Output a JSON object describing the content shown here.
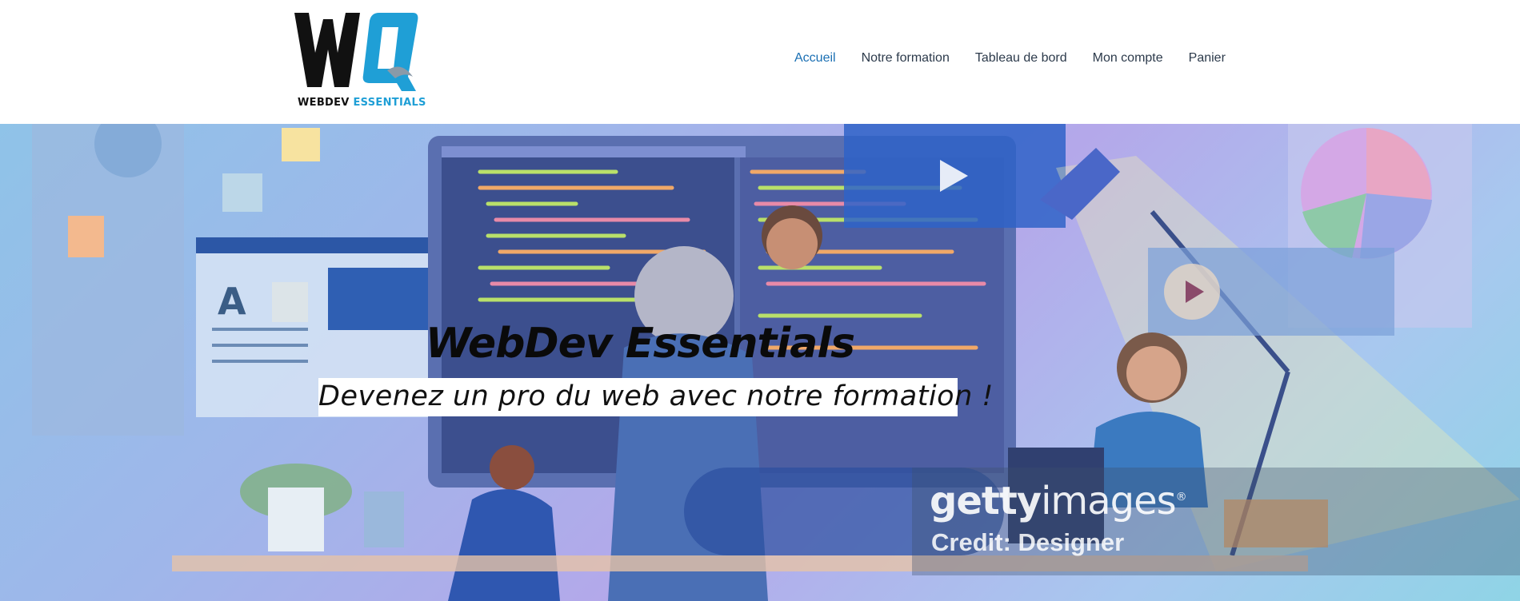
{
  "header": {
    "logo": {
      "monogram": "WQ",
      "word1": "WEBDEV",
      "word2": "ESSENTIALS"
    },
    "nav": [
      {
        "label": "Accueil",
        "active": true
      },
      {
        "label": "Notre formation",
        "active": false
      },
      {
        "label": "Tableau de bord",
        "active": false
      },
      {
        "label": "Mon compte",
        "active": false
      },
      {
        "label": "Panier",
        "active": false
      }
    ]
  },
  "hero": {
    "title": "WebDev Essentials",
    "subtitle": "Devenez un pro du web avec notre formation !",
    "watermark": {
      "brand_bold": "getty",
      "brand_light": "images",
      "registered": "®",
      "credit": "Credit: Designer"
    }
  },
  "colors": {
    "nav_active": "#1a6fb3",
    "nav_text": "#2c3a4b",
    "logo_blue": "#1f9fd6"
  }
}
